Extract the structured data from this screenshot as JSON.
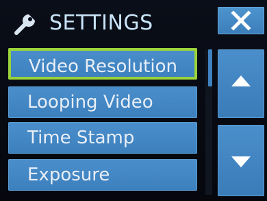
{
  "header": {
    "title": "SETTINGS",
    "icon": "wrench-icon",
    "close_icon": "close-icon"
  },
  "menu": {
    "items": [
      {
        "label": "Video Resolution",
        "selected": true
      },
      {
        "label": "Looping Video",
        "selected": false
      },
      {
        "label": "Time Stamp",
        "selected": false
      },
      {
        "label": "Exposure",
        "selected": false
      }
    ]
  },
  "navigation": {
    "up_icon": "arrow-up-icon",
    "down_icon": "arrow-down-icon"
  },
  "colors": {
    "accent": "#4a8fcb",
    "selection": "#9ad33a",
    "title_text": "#c9e4f8",
    "background": "#05070c"
  }
}
